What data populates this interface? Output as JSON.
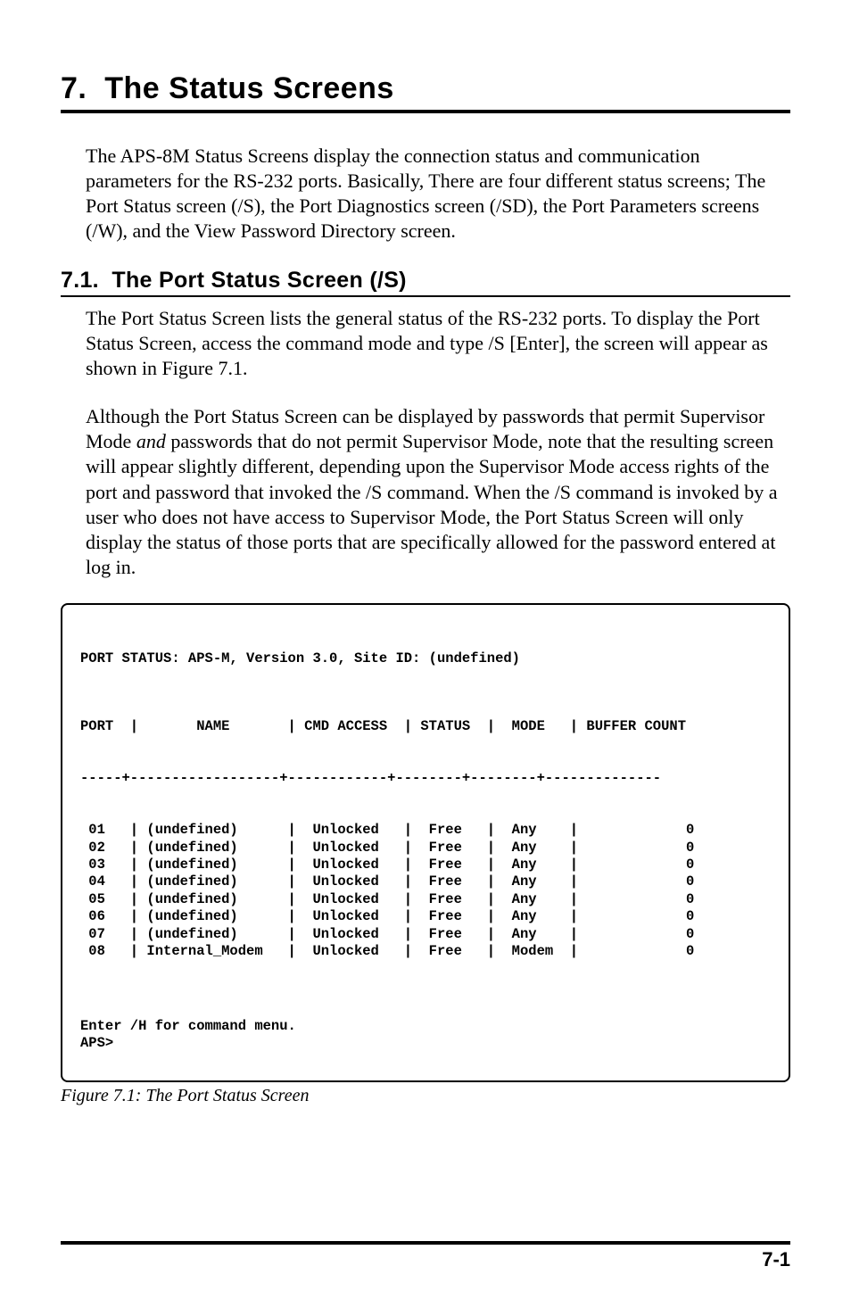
{
  "chapter": {
    "number": "7.",
    "title": "The Status Screens"
  },
  "intro_paragraph": "The APS-8M Status Screens display the connection status and communication parameters for the RS-232 ports.  Basically, There are four different status screens; The Port Status screen (/S), the Port Diagnostics screen (/SD), the Port Parameters screens (/W), and the View Password Directory screen.",
  "section": {
    "number": "7.1.",
    "title": "The Port Status Screen (/S)"
  },
  "section_para1": "The Port Status Screen lists the general status of the RS-232 ports.  To display the Port Status Screen, access the command mode and type /S  [Enter], the screen will appear as shown in Figure 7.1.",
  "section_para2_pre": "Although the Port Status Screen can be displayed by passwords that permit Supervisor Mode ",
  "section_para2_italic": "and",
  "section_para2_post": " passwords that do not permit Supervisor Mode, note that the resulting screen will appear slightly different, depending upon the Supervisor Mode access rights of the port and password that invoked the /S command.  When the /S command is invoked by a user who does not have access to Supervisor Mode, the Port Status Screen will only display the status of those ports that are specifically allowed for the password entered at log in.",
  "terminal": {
    "title_line": "PORT STATUS: APS-M, Version 3.0, Site ID: (undefined)",
    "columns": [
      "PORT",
      "NAME",
      "CMD ACCESS",
      "STATUS",
      "MODE",
      "BUFFER COUNT"
    ],
    "rows": [
      {
        "port": "01",
        "name": "(undefined)",
        "cmd_access": "Unlocked",
        "status": "Free",
        "mode": "Any",
        "buffer_count": "0"
      },
      {
        "port": "02",
        "name": "(undefined)",
        "cmd_access": "Unlocked",
        "status": "Free",
        "mode": "Any",
        "buffer_count": "0"
      },
      {
        "port": "03",
        "name": "(undefined)",
        "cmd_access": "Unlocked",
        "status": "Free",
        "mode": "Any",
        "buffer_count": "0"
      },
      {
        "port": "04",
        "name": "(undefined)",
        "cmd_access": "Unlocked",
        "status": "Free",
        "mode": "Any",
        "buffer_count": "0"
      },
      {
        "port": "05",
        "name": "(undefined)",
        "cmd_access": "Unlocked",
        "status": "Free",
        "mode": "Any",
        "buffer_count": "0"
      },
      {
        "port": "06",
        "name": "(undefined)",
        "cmd_access": "Unlocked",
        "status": "Free",
        "mode": "Any",
        "buffer_count": "0"
      },
      {
        "port": "07",
        "name": "(undefined)",
        "cmd_access": "Unlocked",
        "status": "Free",
        "mode": "Any",
        "buffer_count": "0"
      },
      {
        "port": "08",
        "name": "Internal_Modem",
        "cmd_access": "Unlocked",
        "status": "Free",
        "mode": "Modem",
        "buffer_count": "0"
      }
    ],
    "footer_line1": "Enter /H for command menu.",
    "footer_line2": "APS>"
  },
  "figure_caption": "Figure 7.1:  The Port Status Screen",
  "page_number": "7-1"
}
